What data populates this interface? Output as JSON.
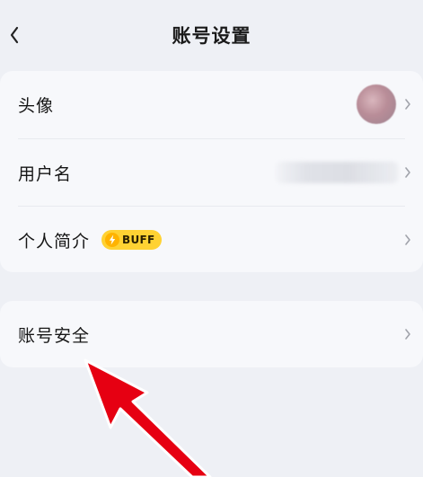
{
  "header": {
    "title": "账号设置",
    "back_icon": "chevron-left-icon"
  },
  "profile_card": {
    "rows": [
      {
        "label": "头像"
      },
      {
        "label": "用户名"
      },
      {
        "label": "个人简介",
        "badge": "BUFF"
      }
    ]
  },
  "security_card": {
    "rows": [
      {
        "label": "账号安全"
      }
    ]
  },
  "colors": {
    "background": "#eef0f5",
    "card": "#f7f8fb",
    "badge": "#ffd233",
    "annotation_arrow": "#e60012"
  }
}
